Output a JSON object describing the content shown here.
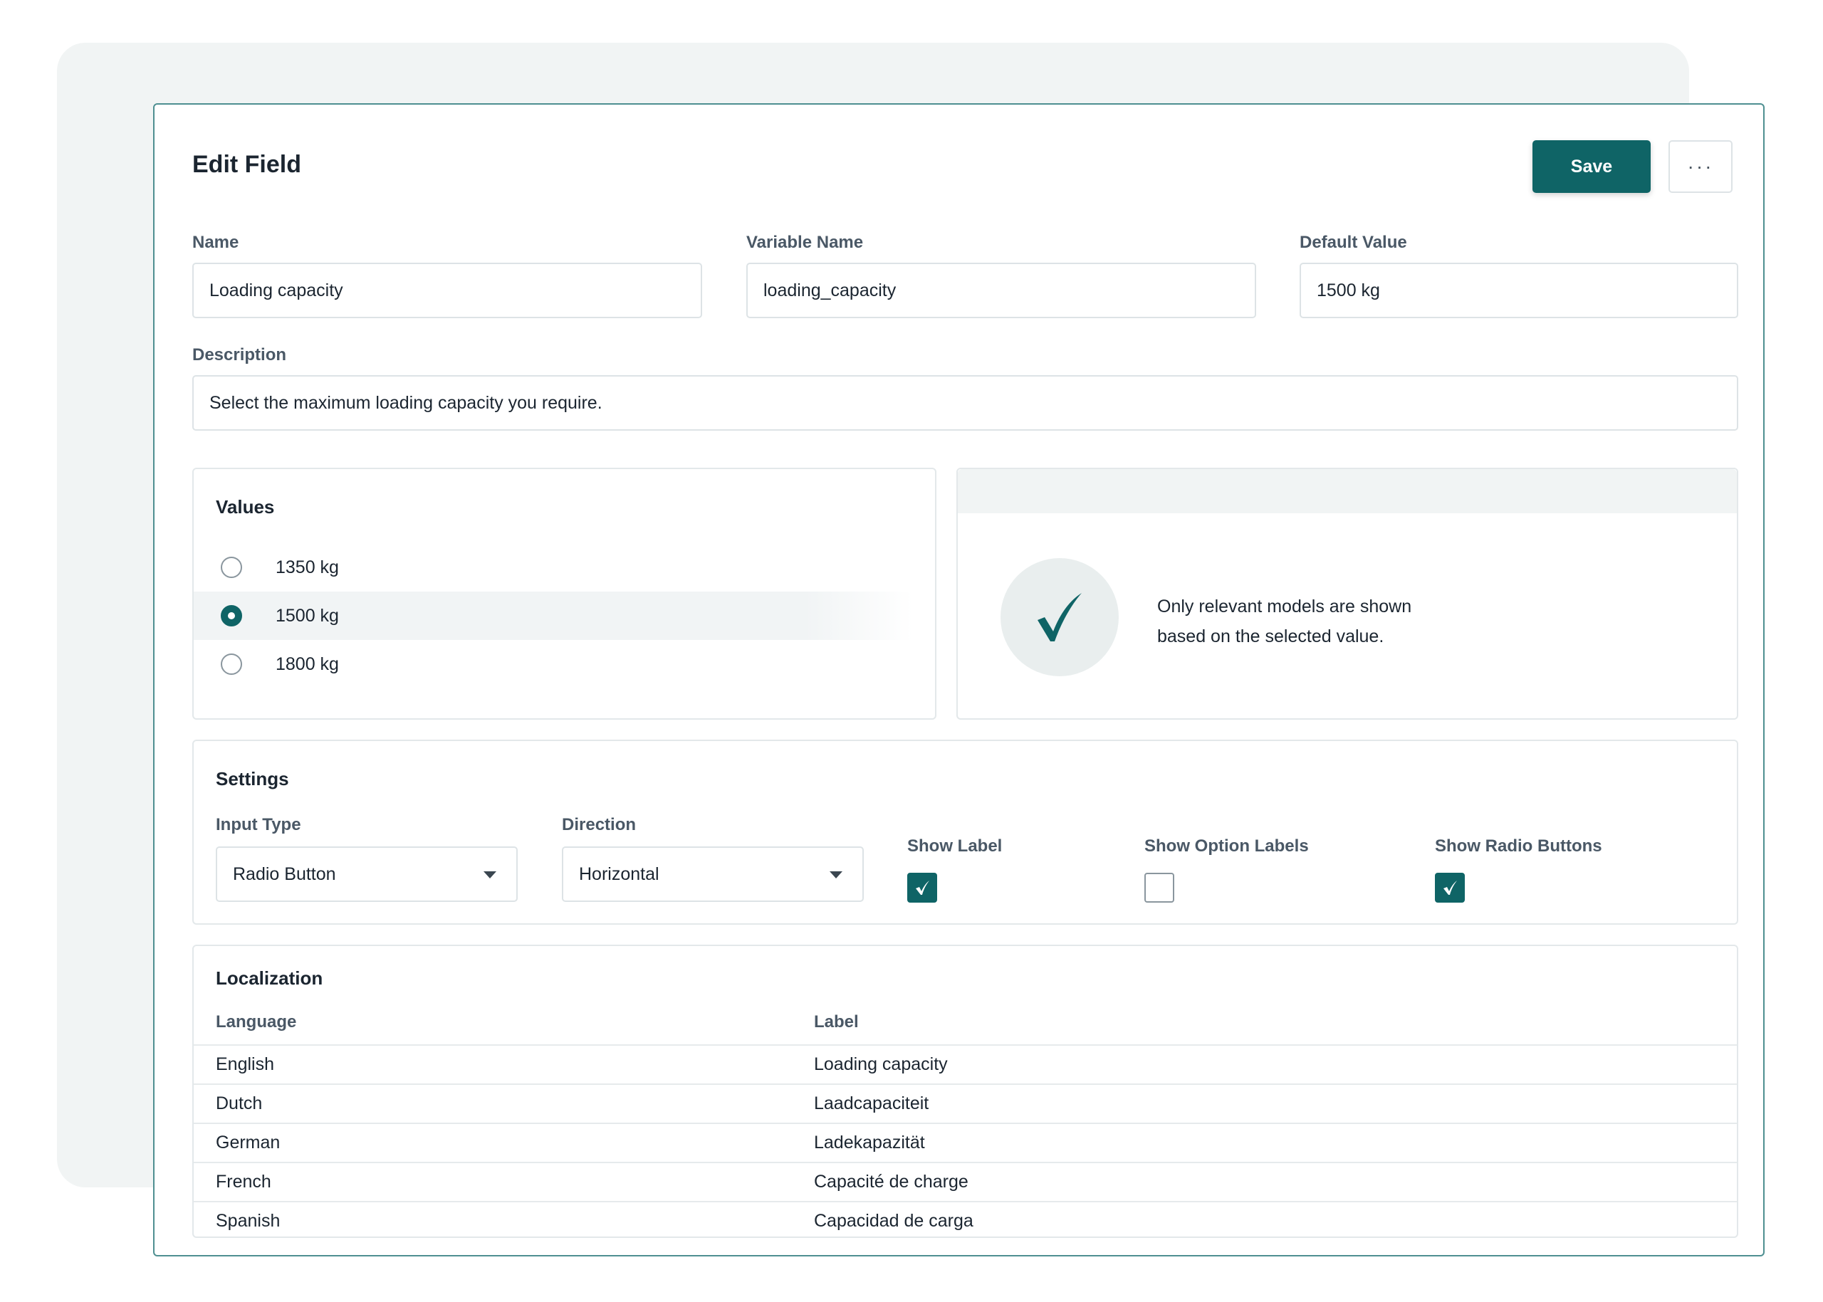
{
  "header": {
    "title": "Edit Field",
    "save_label": "Save",
    "more_label": "···"
  },
  "fields": {
    "name_label": "Name",
    "name_value": "Loading capacity",
    "variable_label": "Variable Name",
    "variable_value": "loading_capacity",
    "default_label": "Default Value",
    "default_value": "1500 kg",
    "description_label": "Description",
    "description_value": "Select the maximum loading capacity you require."
  },
  "values": {
    "title": "Values",
    "options": [
      {
        "label": "1350 kg",
        "selected": false
      },
      {
        "label": "1500 kg",
        "selected": true
      },
      {
        "label": "1800 kg",
        "selected": false
      }
    ]
  },
  "info": {
    "line1": "Only relevant models are shown",
    "line2": "based on the selected value."
  },
  "settings": {
    "title": "Settings",
    "input_type_label": "Input Type",
    "input_type_value": "Radio Button",
    "direction_label": "Direction",
    "direction_value": "Horizontal",
    "show_label": {
      "label": "Show Label",
      "checked": true
    },
    "show_option_labels": {
      "label": "Show Option Labels",
      "checked": false
    },
    "show_radio_buttons": {
      "label": "Show Radio Buttons",
      "checked": true
    }
  },
  "localization": {
    "title": "Localization",
    "col_language": "Language",
    "col_label": "Label",
    "rows": [
      {
        "language": "English",
        "label": "Loading capacity"
      },
      {
        "language": "Dutch",
        "label": "Laadcapaciteit"
      },
      {
        "language": "German",
        "label": "Ladekapazität"
      },
      {
        "language": "French",
        "label": "Capacité de charge"
      },
      {
        "language": "Spanish",
        "label": "Capacidad de carga"
      }
    ]
  },
  "colors": {
    "accent": "#0f6466",
    "border_accent": "#4e8f91",
    "background_card": "#f1f4f4"
  }
}
